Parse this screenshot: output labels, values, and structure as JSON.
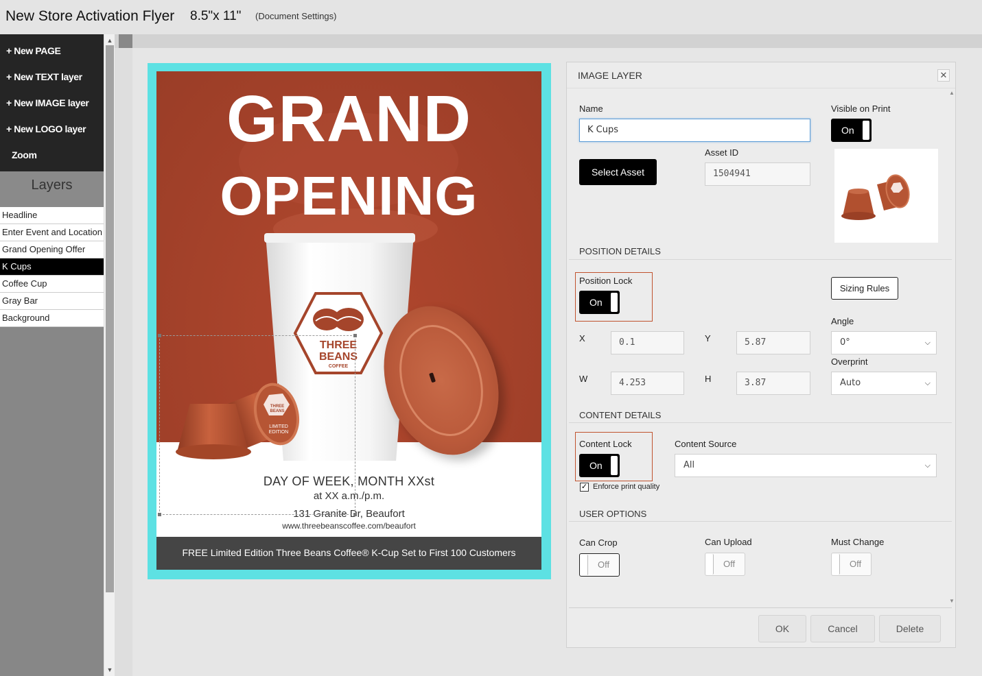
{
  "topbar": {
    "title": "New Store Activation Flyer",
    "size": "8.5\"x 11\"",
    "settings_link": "(Document Settings)"
  },
  "sidebar": {
    "menu": [
      {
        "label": "+ New PAGE"
      },
      {
        "label": "+ New TEXT layer"
      },
      {
        "label": "+ New IMAGE layer"
      },
      {
        "label": "+ New LOGO layer"
      },
      {
        "label": "Zoom"
      }
    ],
    "layers_title": "Layers",
    "layers": [
      {
        "label": "Headline"
      },
      {
        "label": "Enter Event and Location"
      },
      {
        "label": "Grand Opening Offer"
      },
      {
        "label": "K Cups"
      },
      {
        "label": "Coffee Cup"
      },
      {
        "label": "Gray Bar"
      },
      {
        "label": "Background"
      }
    ],
    "active_layer": "K Cups"
  },
  "flyer": {
    "headline1": "GRAND",
    "headline2": "OPENING",
    "logo_line1": "THREE",
    "logo_line2": "BEANS",
    "logo_line3": "COFFEE",
    "kcup_label1": "THREE",
    "kcup_label2": "BEANS",
    "kcup_label3": "LIMITED",
    "kcup_label4": "EDITION",
    "event_line1": "DAY OF WEEK, MONTH XXst",
    "event_line2": "at XX a.m./p.m.",
    "event_line3": "131 Granite Dr, Beaufort",
    "event_line4": "www.threebeanscoffee.com/beaufort",
    "graybar_text": "FREE Limited Edition Three Beans Coffee® K-Cup Set to First 100 Customers",
    "colors": {
      "bleed": "#5de1e3",
      "brand_rust": "#a7432b",
      "graybar": "#454545"
    }
  },
  "panel": {
    "title": "IMAGE LAYER",
    "close_icon": "close-icon",
    "name_label": "Name",
    "name_value": "K Cups",
    "visible_label": "Visible on Print",
    "visible_value": "On",
    "select_asset_label": "Select Asset",
    "asset_id_label": "Asset ID",
    "asset_id_value": "1504941",
    "position_section": "POSITION DETAILS",
    "position_lock_label": "Position Lock",
    "position_lock_value": "On",
    "sizing_rules_label": "Sizing Rules",
    "angle_label": "Angle",
    "angle_value": "0°",
    "overprint_label": "Overprint",
    "overprint_value": "Auto",
    "x_label": "X",
    "x_value": "0.1",
    "y_label": "Y",
    "y_value": "5.87",
    "w_label": "W",
    "w_value": "4.253",
    "h_label": "H",
    "h_value": "3.87",
    "content_section": "CONTENT DETAILS",
    "content_lock_label": "Content Lock",
    "content_lock_value": "On",
    "content_source_label": "Content Source",
    "content_source_value": "All",
    "enforce_label": "Enforce print quality",
    "enforce_checked": true,
    "user_section": "USER OPTIONS",
    "can_crop_label": "Can Crop",
    "can_crop_value": "Off",
    "can_upload_label": "Can Upload",
    "can_upload_value": "Off",
    "must_change_label": "Must Change",
    "must_change_value": "Off",
    "ok_label": "OK",
    "cancel_label": "Cancel",
    "delete_label": "Delete",
    "highlight_color": "#c0522d"
  }
}
